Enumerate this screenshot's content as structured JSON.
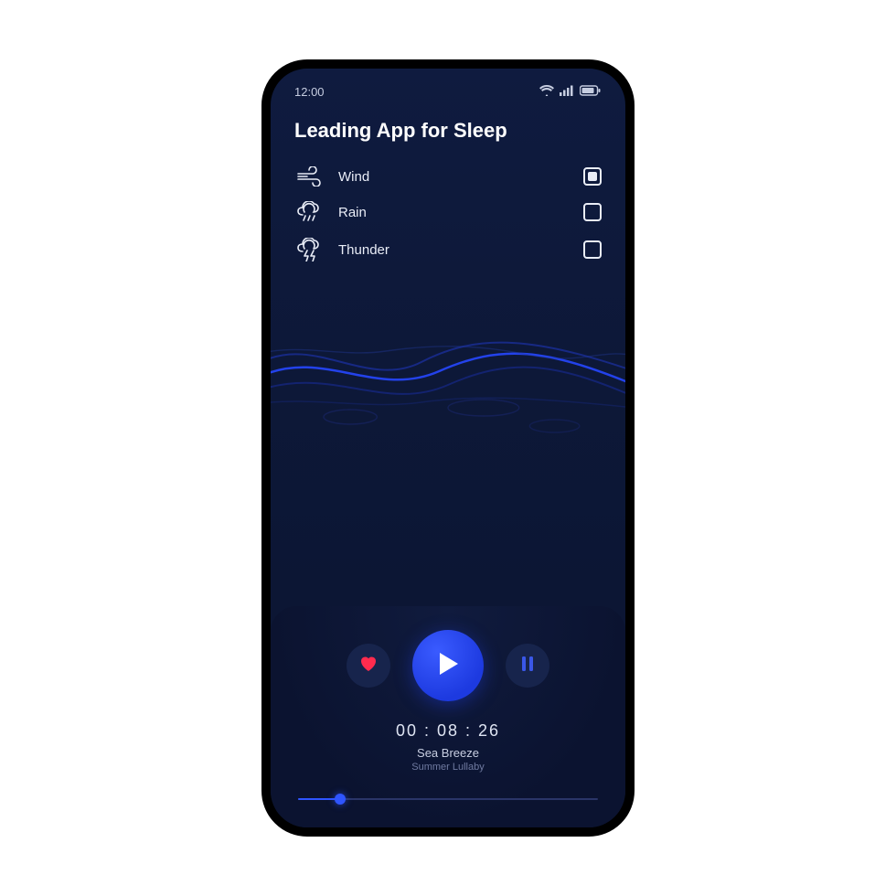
{
  "statusbar": {
    "time": "12:00"
  },
  "header": {
    "title": "Leading App for Sleep"
  },
  "sounds": [
    {
      "icon": "wind-icon",
      "label": "Wind",
      "checked": true
    },
    {
      "icon": "rain-icon",
      "label": "Rain",
      "checked": false
    },
    {
      "icon": "thunder-icon",
      "label": "Thunder",
      "checked": false
    }
  ],
  "player": {
    "timer": "00 : 08 : 26",
    "track_title": "Sea Breeze",
    "track_subtitle": "Summer Lullaby",
    "progress_percent": 14
  },
  "colors": {
    "accent": "#2f55ff",
    "bg_top": "#0f1b3f",
    "bg_bottom": "#0b1430",
    "heart": "#ff2b4e"
  }
}
